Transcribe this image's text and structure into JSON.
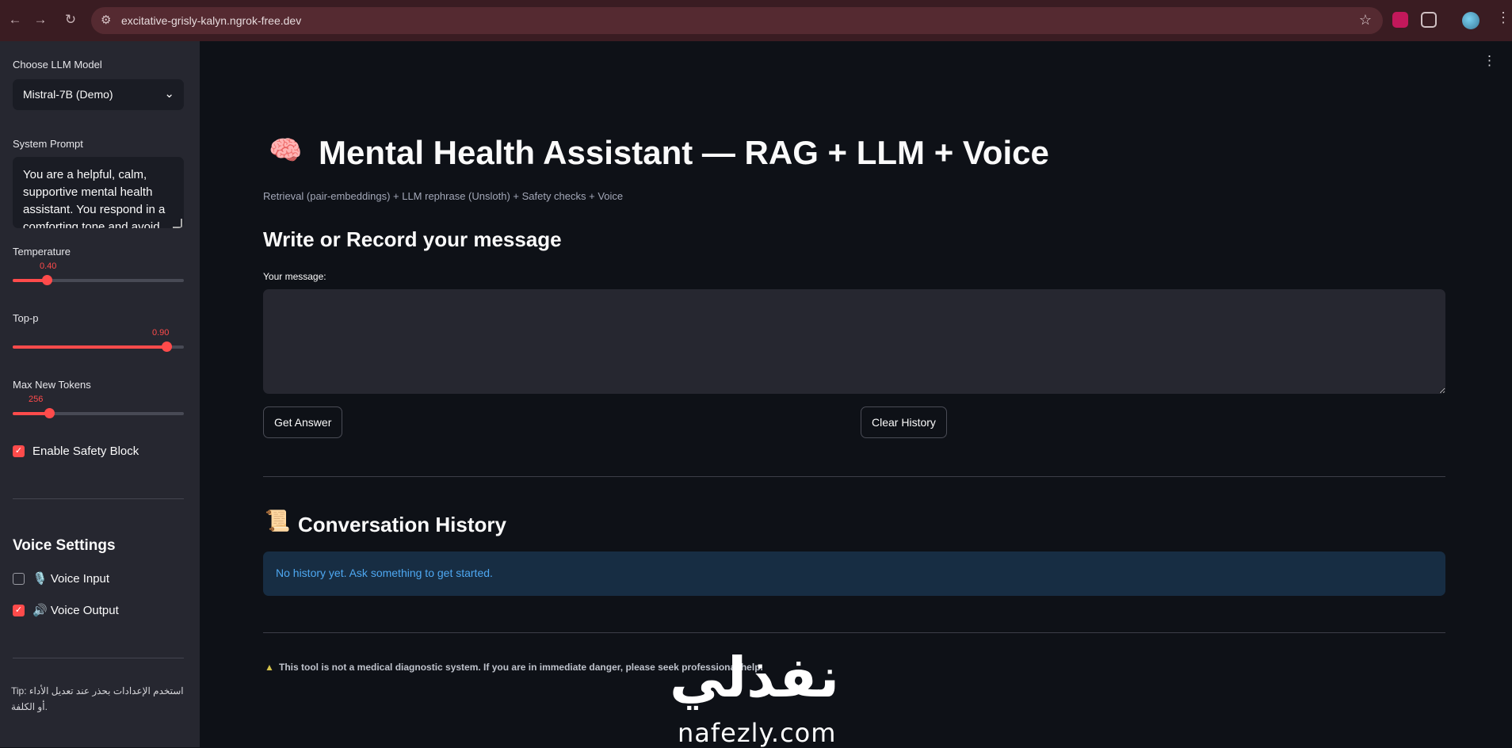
{
  "browser": {
    "url": "excitative-grisly-kalyn.ngrok-free.dev",
    "icons": [
      "back-icon",
      "forward-icon",
      "reload-icon",
      "site-settings-icon",
      "bookmark-star-icon",
      "extension-icon",
      "puzzle-icon",
      "profile-avatar",
      "menu-icon"
    ]
  },
  "sidebar": {
    "model_label": "Choose LLM Model",
    "model_value": "Mistral-7B (Demo)",
    "prompt_label": "System Prompt",
    "prompt_text": "You are a helpful, calm, supportive mental health assistant. You respond in a comforting tone and avoid",
    "temperature": {
      "label": "Temperature",
      "value_text": "0.40",
      "value": 0.4,
      "min": 0,
      "max": 2
    },
    "top_p": {
      "label": "Top-p",
      "value_text": "0.90",
      "value": 0.9,
      "min": 0,
      "max": 1
    },
    "max_tokens": {
      "label": "Max New Tokens",
      "value_text": "256",
      "value": 256,
      "min": 0,
      "max": 1200
    },
    "safety": {
      "label": "Enable Safety Block",
      "checked": true
    },
    "voice_heading": "Voice Settings",
    "voice_input": {
      "label": "🎙️ Voice Input",
      "checked": false
    },
    "voice_output": {
      "label": "🔊 Voice Output",
      "checked": true
    },
    "tip": "Tip: استخدم الإعدادات بحذر عند تعديل الأداء أو الكلفة."
  },
  "main": {
    "title_icon": "🧠",
    "title": "Mental Health Assistant — RAG + LLM + Voice",
    "subtitle": "Retrieval (pair-embeddings) + LLM rephrase (Unsloth) + Safety checks + Voice",
    "section_heading": "Write or Record your message",
    "message_label": "Your message:",
    "message_value": "",
    "get_answer": "Get Answer",
    "clear_history": "Clear History",
    "history_icon": "📜",
    "history_heading": "Conversation History",
    "history_empty": "No history yet. Ask something to get started.",
    "disclaimer": "This tool is not a medical diagnostic system. If you are in immediate danger, please seek professional help."
  },
  "watermark": {
    "arabic": "نفذلي",
    "latin": "nafezly.com"
  },
  "colors": {
    "accent": "#ff4b4b",
    "info_bg": "#172d43",
    "info_text": "#4ea8f2",
    "sidebar_bg": "#262730",
    "main_bg": "#0e1117"
  }
}
